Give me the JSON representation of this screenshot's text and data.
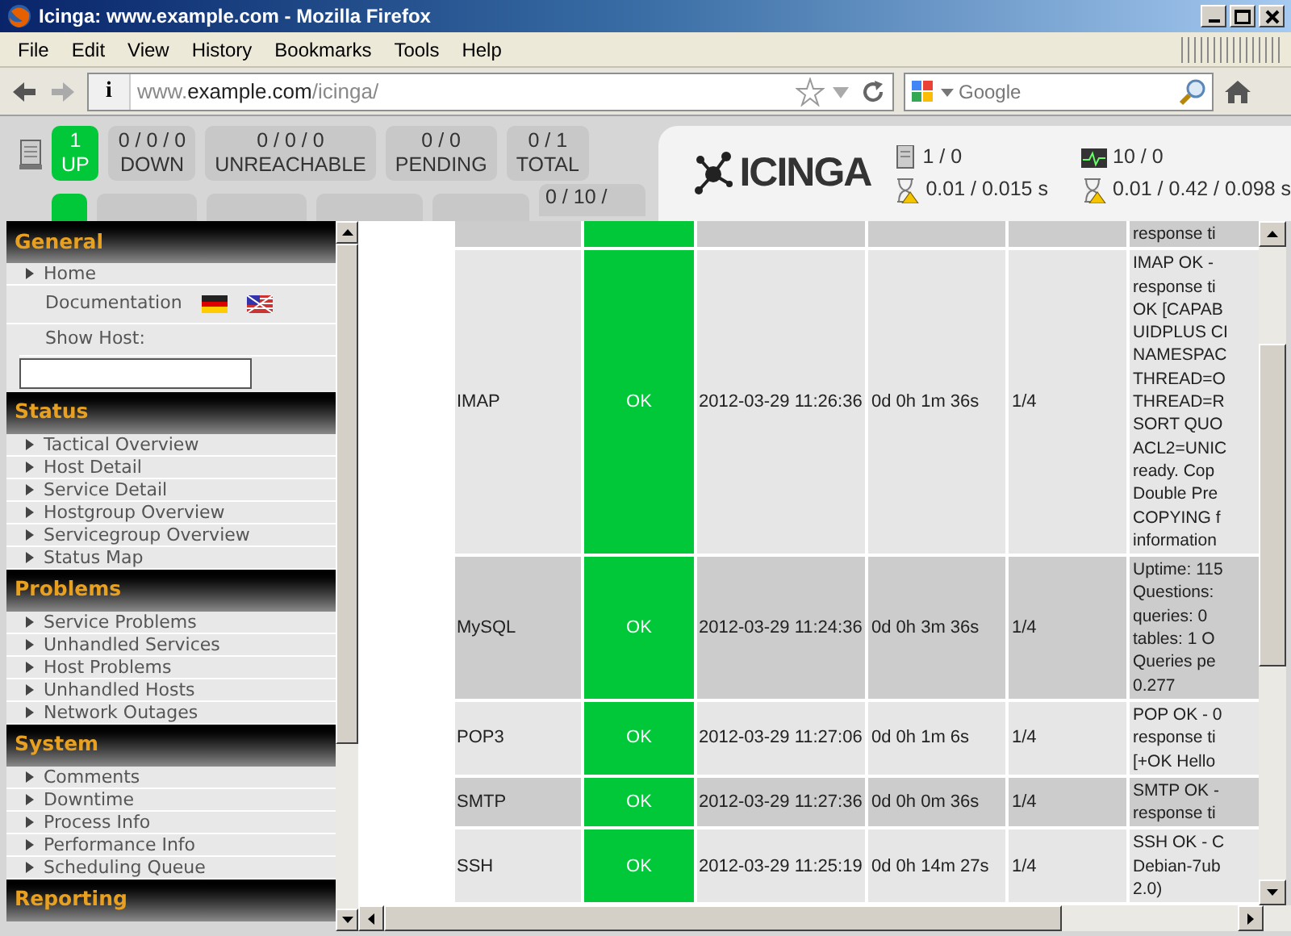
{
  "window": {
    "title": "Icinga: www.example.com - Mozilla Firefox"
  },
  "menu": [
    "File",
    "Edit",
    "View",
    "History",
    "Bookmarks",
    "Tools",
    "Help"
  ],
  "toolbar": {
    "identity": "i",
    "url": {
      "prefix": "www.",
      "domain": "example.com",
      "path": "/icinga/"
    },
    "search_placeholder": "Google"
  },
  "host_status": [
    {
      "count": "1",
      "label": "UP",
      "kind": "up"
    },
    {
      "count": "0 / 0 / 0",
      "label": "DOWN",
      "kind": "neutral"
    },
    {
      "count": "0 / 0 / 0",
      "label": "UNREACHABLE",
      "kind": "neutral"
    },
    {
      "count": "0 / 0",
      "label": "PENDING",
      "kind": "neutral"
    },
    {
      "count": "0 / 1",
      "label": "TOTAL",
      "kind": "neutral"
    }
  ],
  "service_status": [
    {
      "kind": "up"
    },
    {
      "kind": "neutral"
    },
    {
      "kind": "neutral"
    },
    {
      "kind": "neutral"
    },
    {
      "kind": "neutral"
    },
    {
      "kind": "neutral",
      "count": "0 / 10 /"
    }
  ],
  "summary": {
    "logo": "ICINGA",
    "hosts": "1 / 0",
    "host_times": "0.01 / 0.015 s",
    "services": "10 / 0",
    "service_times": "0.01 / 0.42 / 0.098 s"
  },
  "sidebar": {
    "sections": [
      {
        "title": "General",
        "items": [
          {
            "label": "Home",
            "kind": "link"
          },
          {
            "label": "Documentation",
            "kind": "docs"
          },
          {
            "label": "Show Host:",
            "kind": "search"
          }
        ]
      },
      {
        "title": "Status",
        "items": [
          {
            "label": "Tactical Overview",
            "kind": "link"
          },
          {
            "label": "Host Detail",
            "kind": "link"
          },
          {
            "label": "Service Detail",
            "kind": "link"
          },
          {
            "label": "Hostgroup Overview",
            "kind": "link"
          },
          {
            "label": "Servicegroup Overview",
            "kind": "link"
          },
          {
            "label": "Status Map",
            "kind": "link"
          }
        ]
      },
      {
        "title": "Problems",
        "items": [
          {
            "label": "Service Problems",
            "kind": "link"
          },
          {
            "label": "Unhandled Services",
            "kind": "link"
          },
          {
            "label": "Host Problems",
            "kind": "link"
          },
          {
            "label": "Unhandled Hosts",
            "kind": "link"
          },
          {
            "label": "Network Outages",
            "kind": "link"
          }
        ]
      },
      {
        "title": "System",
        "items": [
          {
            "label": "Comments",
            "kind": "link"
          },
          {
            "label": "Downtime",
            "kind": "link"
          },
          {
            "label": "Process Info",
            "kind": "link"
          },
          {
            "label": "Performance Info",
            "kind": "link"
          },
          {
            "label": "Scheduling Queue",
            "kind": "link"
          }
        ]
      },
      {
        "title": "Reporting"
      }
    ]
  },
  "table": {
    "rows": [
      {
        "info": [
          "response ti"
        ]
      },
      {
        "service": "IMAP",
        "status": "OK",
        "last_check": "2012-03-29 11:26:36",
        "duration": "0d 0h 1m 36s",
        "attempt": "1/4",
        "info": [
          "IMAP OK -",
          "response ti",
          "OK [CAPAB",
          "UIDPLUS CI",
          "NAMESPAC",
          "THREAD=O",
          "THREAD=R",
          "SORT QUO",
          "ACL2=UNIC",
          "ready. Cop",
          "Double Pre",
          "COPYING f",
          "information"
        ]
      },
      {
        "service": "MySQL",
        "status": "OK",
        "last_check": "2012-03-29 11:24:36",
        "duration": "0d 0h 3m 36s",
        "attempt": "1/4",
        "info": [
          "Uptime: 115",
          "Questions:",
          "queries: 0",
          "tables: 1 O",
          "Queries pe",
          "0.277"
        ]
      },
      {
        "service": "POP3",
        "status": "OK",
        "last_check": "2012-03-29 11:27:06",
        "duration": "0d 0h 1m 6s",
        "attempt": "1/4",
        "info": [
          "POP OK - 0",
          "response ti",
          "[+OK Hello"
        ]
      },
      {
        "service": "SMTP",
        "status": "OK",
        "last_check": "2012-03-29 11:27:36",
        "duration": "0d 0h 0m 36s",
        "attempt": "1/4",
        "info": [
          "SMTP OK -",
          "response ti"
        ]
      },
      {
        "service": "SSH",
        "status": "OK",
        "last_check": "2012-03-29 11:25:19",
        "duration": "0d 0h 14m 27s",
        "attempt": "1/4",
        "info": [
          "SSH OK - C",
          "Debian-7ub",
          "2.0)"
        ]
      }
    ]
  }
}
